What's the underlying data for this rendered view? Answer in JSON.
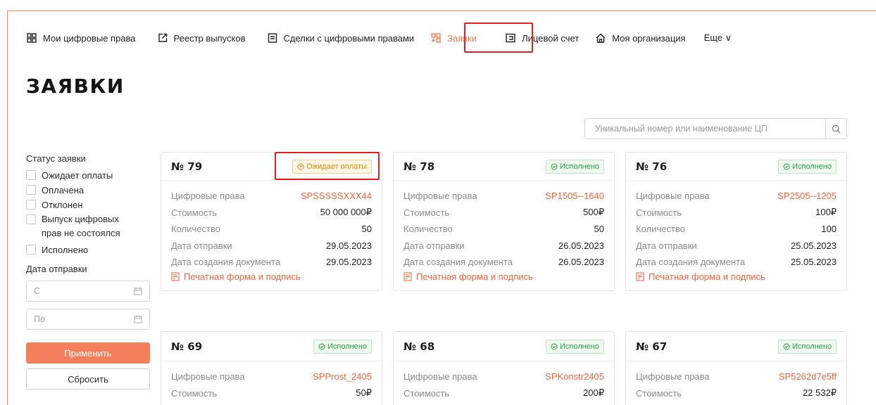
{
  "nav": {
    "items": [
      {
        "label": "Мои цифровые права",
        "icon": "grid-icon"
      },
      {
        "label": "Реестр выпусков",
        "icon": "external-link-icon"
      },
      {
        "label": "Сделки с цифровыми правами",
        "icon": "document-icon"
      },
      {
        "label": "Заявки",
        "icon": "grid-plus-icon"
      },
      {
        "label": "Лицевой счет",
        "icon": "wallet-icon"
      },
      {
        "label": "Моя организация",
        "icon": "home-icon"
      },
      {
        "label": "Еще ∨",
        "icon": ""
      }
    ]
  },
  "page": {
    "title": "ЗАЯВКИ"
  },
  "search": {
    "placeholder": "Уникальный номер или наименование ЦП"
  },
  "filters": {
    "status_label": "Статус заявки",
    "statuses": [
      "Ожидает оплаты",
      "Оплачена",
      "Отклонен",
      "Выпуск цифровых прав не состоялся",
      "Исполнено"
    ],
    "date_label": "Дата отправки",
    "date_from_placeholder": "С",
    "date_to_placeholder": "По",
    "apply_label": "Применить",
    "reset_label": "Сбросить"
  },
  "card_labels": {
    "rights": "Цифровые права",
    "cost": "Стоимость",
    "quantity": "Количество",
    "sent_date": "Дата отправки",
    "doc_date": "Дата создания документа",
    "print_link": "Печатная форма и подпись"
  },
  "cards": [
    {
      "number": "№ 79",
      "status": "Ожидает оплаты",
      "rights": "SPSSSSSXXX44",
      "cost": "50 000 000₽",
      "quantity": "50",
      "sent_date": "29.05.2023",
      "doc_date": "29.05.2023"
    },
    {
      "number": "№ 78",
      "status": "Исполнено",
      "rights": "SP1505--1640",
      "cost": "500₽",
      "quantity": "50",
      "sent_date": "26.05.2023",
      "doc_date": "26.05.2023"
    },
    {
      "number": "№ 76",
      "status": "Исполнено",
      "rights": "SP2505--1205",
      "cost": "100₽",
      "quantity": "100",
      "sent_date": "25.05.2023",
      "doc_date": "25.05.2023"
    },
    {
      "number": "№ 69",
      "status": "Исполнено",
      "rights": "SPProst_2405",
      "cost": "50₽"
    },
    {
      "number": "№ 68",
      "status": "Исполнено",
      "rights": "SPKonstr2405",
      "cost": "200₽"
    },
    {
      "number": "№ 67",
      "status": "Исполнено",
      "rights": "SP5262d7e5ff",
      "cost": "22 532₽"
    }
  ],
  "colors": {
    "accent": "#f0643c",
    "button": "#f47f5a",
    "highlight": "#e32020",
    "done": "#2ea047",
    "wait": "#d88a14"
  }
}
